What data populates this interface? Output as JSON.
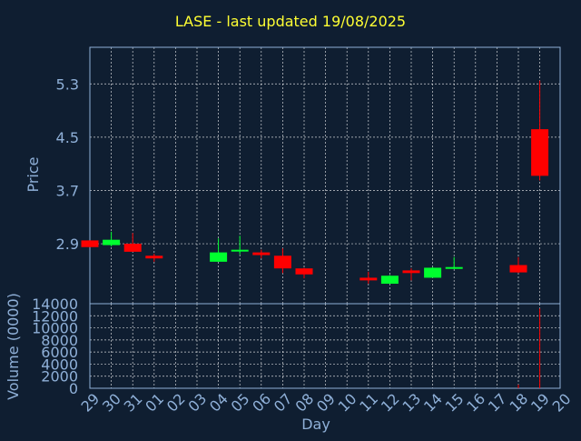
{
  "chart_data": {
    "type": "candlestick",
    "title": "LASE - last updated 19/08/2025",
    "xlabel": "Day",
    "ylabel_price": "Price",
    "ylabel_volume": "Volume (0000)",
    "grid": true,
    "days": [
      "29",
      "30",
      "31",
      "01",
      "02",
      "03",
      "04",
      "05",
      "06",
      "07",
      "08",
      "09",
      "10",
      "11",
      "12",
      "13",
      "14",
      "15",
      "16",
      "17",
      "18",
      "19",
      "20"
    ],
    "price_ylim": [
      2.0,
      5.85
    ],
    "price_ticks": [
      "2.9",
      "3.7",
      "4.5",
      "5.3"
    ],
    "volume_ylim": [
      0,
      14000
    ],
    "volume_ticks": [
      "0",
      "2000",
      "4000",
      "6000",
      "8000",
      "10000",
      "12000",
      "14000"
    ],
    "candles": [
      {
        "day": "29",
        "open": 2.95,
        "close": 2.85,
        "high": 2.95,
        "low": 2.85
      },
      {
        "day": "30",
        "open": 2.88,
        "close": 2.96,
        "high": 3.08,
        "low": 2.86
      },
      {
        "day": "31",
        "open": 2.9,
        "close": 2.78,
        "high": 3.06,
        "low": 2.78
      },
      {
        "day": "01",
        "open": 2.72,
        "close": 2.68,
        "high": 2.75,
        "low": 2.63
      },
      {
        "day": "04",
        "open": 2.63,
        "close": 2.77,
        "high": 2.98,
        "low": 2.63
      },
      {
        "day": "05",
        "open": 2.79,
        "close": 2.81,
        "high": 3.02,
        "low": 2.74
      },
      {
        "day": "06",
        "open": 2.77,
        "close": 2.73,
        "high": 2.81,
        "low": 2.68
      },
      {
        "day": "07",
        "open": 2.72,
        "close": 2.53,
        "high": 2.83,
        "low": 2.46
      },
      {
        "day": "08",
        "open": 2.53,
        "close": 2.44,
        "high": 2.54,
        "low": 2.38
      },
      {
        "day": "11",
        "open": 2.39,
        "close": 2.35,
        "high": 2.48,
        "low": 2.3
      },
      {
        "day": "12",
        "open": 2.3,
        "close": 2.42,
        "high": 2.43,
        "low": 2.3
      },
      {
        "day": "13",
        "open": 2.5,
        "close": 2.46,
        "high": 2.53,
        "low": 2.35
      },
      {
        "day": "14",
        "open": 2.39,
        "close": 2.54,
        "high": 2.55,
        "low": 2.39
      },
      {
        "day": "15",
        "open": 2.53,
        "close": 2.55,
        "high": 2.7,
        "low": 2.52
      },
      {
        "day": "18",
        "open": 2.58,
        "close": 2.47,
        "high": 2.7,
        "low": 2.46
      },
      {
        "day": "19",
        "open": 4.62,
        "close": 3.92,
        "high": 5.35,
        "low": 3.85
      }
    ],
    "volumes": [
      {
        "day": "18",
        "value": 600
      },
      {
        "day": "19",
        "value": 13200
      }
    ],
    "colors": {
      "background": "#0f1e31",
      "up": "#00ff2f",
      "down": "#ff0000",
      "grid": "#ffffff",
      "axis_text": "#8fb0d8",
      "title": "#ffff33"
    }
  }
}
